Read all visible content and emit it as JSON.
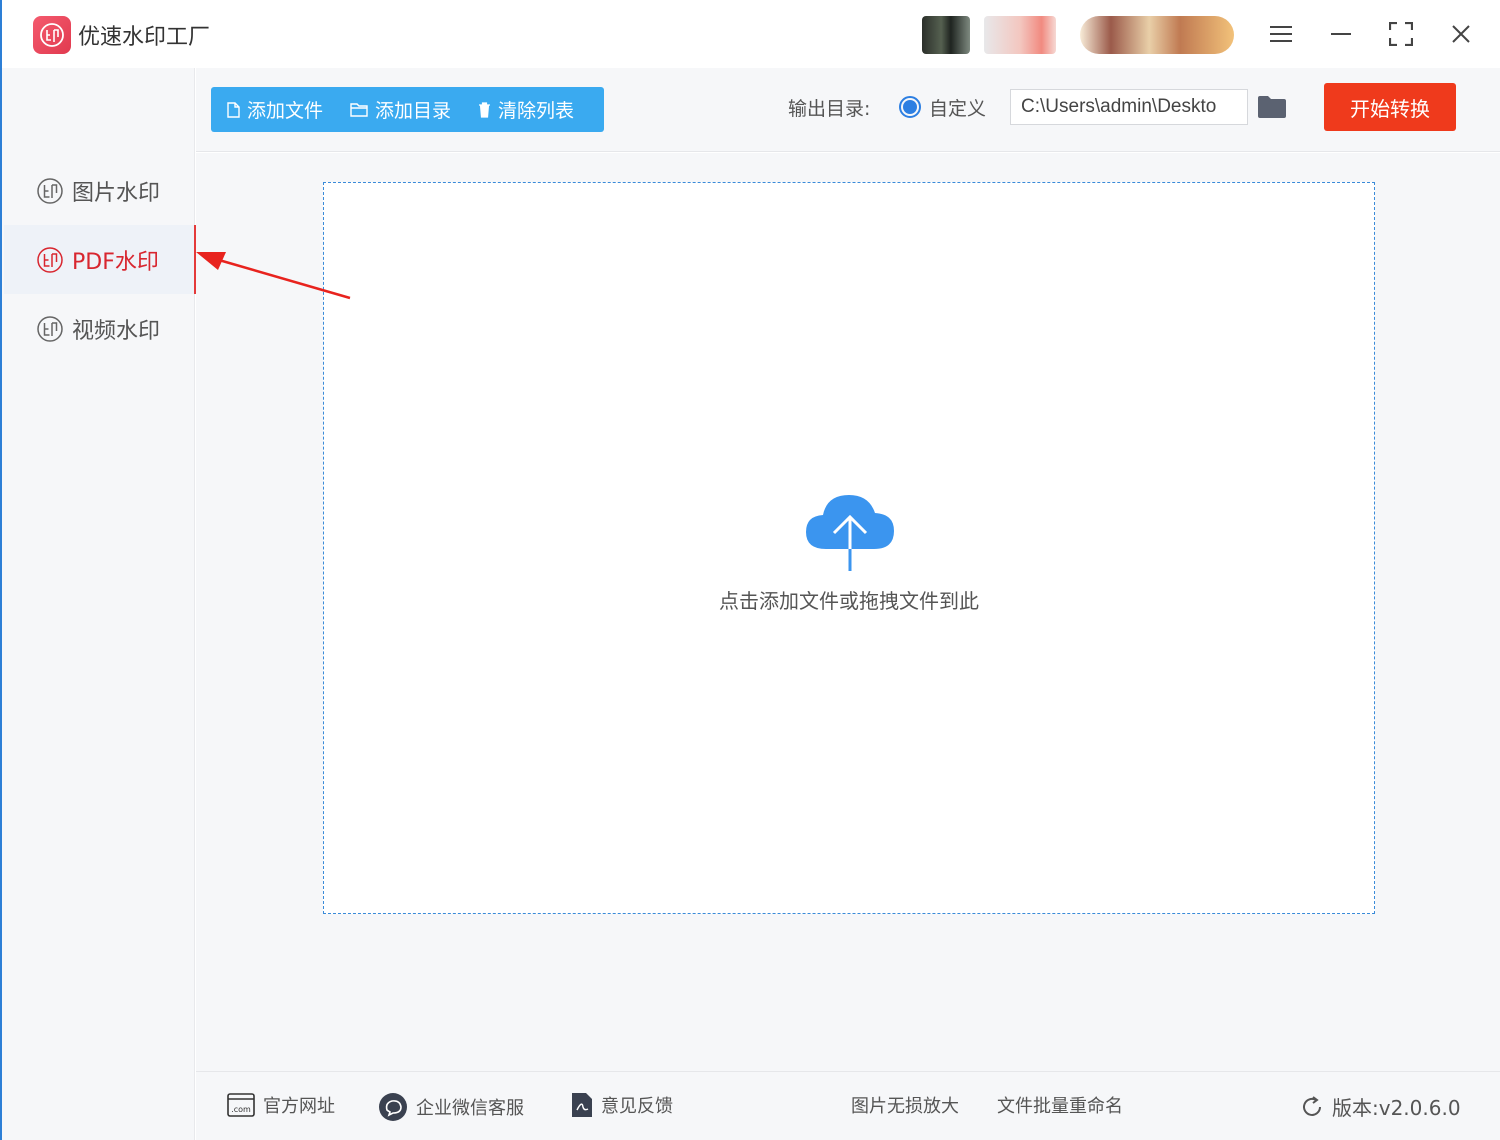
{
  "app": {
    "title": "优速水印工厂",
    "logo_glyph": "印"
  },
  "window": {
    "menu_icon": "hamburger-icon",
    "minimize_icon": "minimize-icon",
    "maximize_icon": "maximize-icon",
    "close_icon": "close-icon"
  },
  "sidebar": {
    "items": [
      {
        "label": "图片水印",
        "icon": "stamp-icon",
        "active": false
      },
      {
        "label": "PDF水印",
        "icon": "stamp-icon",
        "active": true
      },
      {
        "label": "视频水印",
        "icon": "stamp-icon",
        "active": false
      }
    ]
  },
  "toolbar": {
    "add_file": "添加文件",
    "add_folder": "添加目录",
    "clear_list": "清除列表",
    "output_label": "输出目录:",
    "custom_option": "自定义",
    "output_path": "C:\\Users\\admin\\Deskto",
    "start_button": "开始转换"
  },
  "dropzone": {
    "text": "点击添加文件或拖拽文件到此"
  },
  "footer": {
    "website": "官方网址",
    "wechat_service": "企业微信客服",
    "feedback": "意见反馈",
    "image_enlarge": "图片无损放大",
    "batch_rename": "文件批量重命名",
    "version": "版本:v2.0.6.0"
  },
  "colors": {
    "accent_blue": "#3aaaf0",
    "start_red": "#ef3a1c",
    "active_red": "#d8262f",
    "radio_blue": "#2d7fe2"
  }
}
